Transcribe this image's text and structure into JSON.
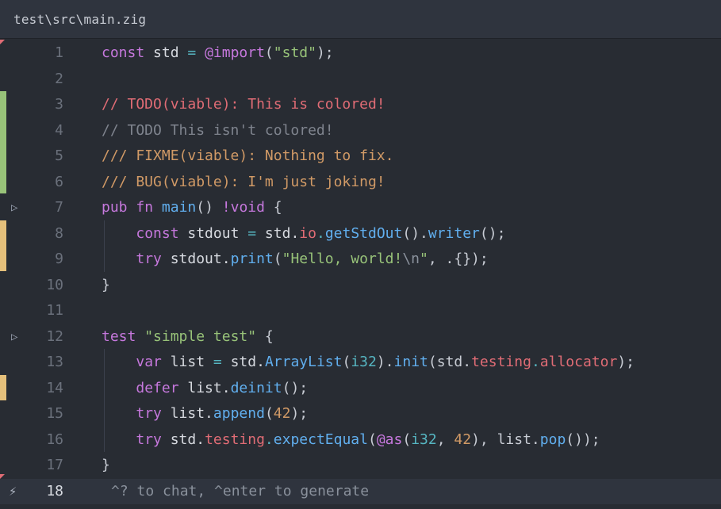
{
  "tab": {
    "path": "test\\src\\main.zig"
  },
  "colors": {
    "background": "#282c33",
    "keyword": "#c678dd",
    "string": "#98c379",
    "function": "#61afef",
    "type": "#56b6c2",
    "number": "#d19a66",
    "todo_comment": "#e06c75",
    "comment": "#7f848e",
    "doc_comment": "#d19a66",
    "git_added": "#98c379",
    "git_modified": "#e5c07b"
  },
  "lines": [
    {
      "number": "1",
      "tokens": [
        {
          "t": "const",
          "c": "k"
        },
        {
          "t": " std ",
          "c": "i"
        },
        {
          "t": "=",
          "c": "t"
        },
        {
          "t": " ",
          "c": "p"
        },
        {
          "t": "@import",
          "c": "k"
        },
        {
          "t": "(",
          "c": "p"
        },
        {
          "t": "\"std\"",
          "c": "s"
        },
        {
          "t": ");",
          "c": "p"
        }
      ]
    },
    {
      "number": "2",
      "tokens": []
    },
    {
      "number": "3",
      "tokens": [
        {
          "t": "// TODO(viable): This is colored!",
          "c": "c1"
        }
      ]
    },
    {
      "number": "4",
      "tokens": [
        {
          "t": "// TODO This isn't colored!",
          "c": "c0"
        }
      ]
    },
    {
      "number": "5",
      "tokens": [
        {
          "t": "/// FIXME(viable): Nothing to fix.",
          "c": "c2"
        }
      ]
    },
    {
      "number": "6",
      "tokens": [
        {
          "t": "/// BUG(viable): I'm just joking!",
          "c": "c2"
        }
      ]
    },
    {
      "number": "7",
      "tokens": [
        {
          "t": "pub",
          "c": "k"
        },
        {
          "t": " ",
          "c": "p"
        },
        {
          "t": "fn",
          "c": "k"
        },
        {
          "t": " ",
          "c": "p"
        },
        {
          "t": "main",
          "c": "f"
        },
        {
          "t": "() ",
          "c": "p"
        },
        {
          "t": "!",
          "c": "k"
        },
        {
          "t": "void",
          "c": "k"
        },
        {
          "t": " {",
          "c": "p"
        }
      ]
    },
    {
      "number": "8",
      "tokens": [
        {
          "t": "    ",
          "c": "p"
        },
        {
          "t": "const",
          "c": "k"
        },
        {
          "t": " stdout ",
          "c": "i"
        },
        {
          "t": "=",
          "c": "t"
        },
        {
          "t": " std.",
          "c": "i"
        },
        {
          "t": "io",
          "c": "m"
        },
        {
          "t": ".",
          "c": "t"
        },
        {
          "t": "getStdOut",
          "c": "f"
        },
        {
          "t": "().",
          "c": "p"
        },
        {
          "t": "writer",
          "c": "f"
        },
        {
          "t": "();",
          "c": "p"
        }
      ]
    },
    {
      "number": "9",
      "tokens": [
        {
          "t": "    ",
          "c": "p"
        },
        {
          "t": "try",
          "c": "k"
        },
        {
          "t": " stdout.",
          "c": "i"
        },
        {
          "t": "print",
          "c": "f"
        },
        {
          "t": "(",
          "c": "p"
        },
        {
          "t": "\"Hello, world!",
          "c": "s"
        },
        {
          "t": "\\n",
          "c": "esc"
        },
        {
          "t": "\"",
          "c": "s"
        },
        {
          "t": ", .{});",
          "c": "p"
        }
      ]
    },
    {
      "number": "10",
      "tokens": [
        {
          "t": "}",
          "c": "p"
        }
      ]
    },
    {
      "number": "11",
      "tokens": []
    },
    {
      "number": "12",
      "tokens": [
        {
          "t": "test",
          "c": "k"
        },
        {
          "t": " ",
          "c": "p"
        },
        {
          "t": "\"simple test\"",
          "c": "s"
        },
        {
          "t": " {",
          "c": "p"
        }
      ]
    },
    {
      "number": "13",
      "tokens": [
        {
          "t": "    ",
          "c": "p"
        },
        {
          "t": "var",
          "c": "k"
        },
        {
          "t": " list ",
          "c": "i"
        },
        {
          "t": "=",
          "c": "t"
        },
        {
          "t": " std.",
          "c": "i"
        },
        {
          "t": "ArrayList",
          "c": "f"
        },
        {
          "t": "(",
          "c": "p"
        },
        {
          "t": "i32",
          "c": "t"
        },
        {
          "t": ").",
          "c": "p"
        },
        {
          "t": "init",
          "c": "f"
        },
        {
          "t": "(std.",
          "c": "p"
        },
        {
          "t": "testing",
          "c": "m"
        },
        {
          "t": ".",
          "c": "t"
        },
        {
          "t": "allocator",
          "c": "m"
        },
        {
          "t": ");",
          "c": "p"
        }
      ]
    },
    {
      "number": "14",
      "tokens": [
        {
          "t": "    ",
          "c": "p"
        },
        {
          "t": "defer",
          "c": "k"
        },
        {
          "t": " list.",
          "c": "i"
        },
        {
          "t": "deinit",
          "c": "f"
        },
        {
          "t": "();",
          "c": "p"
        }
      ]
    },
    {
      "number": "15",
      "tokens": [
        {
          "t": "    ",
          "c": "p"
        },
        {
          "t": "try",
          "c": "k"
        },
        {
          "t": " list.",
          "c": "i"
        },
        {
          "t": "append",
          "c": "f"
        },
        {
          "t": "(",
          "c": "p"
        },
        {
          "t": "42",
          "c": "n"
        },
        {
          "t": ");",
          "c": "p"
        }
      ]
    },
    {
      "number": "16",
      "tokens": [
        {
          "t": "    ",
          "c": "p"
        },
        {
          "t": "try",
          "c": "k"
        },
        {
          "t": " std.",
          "c": "i"
        },
        {
          "t": "testing",
          "c": "m"
        },
        {
          "t": ".",
          "c": "t"
        },
        {
          "t": "expectEqual",
          "c": "f"
        },
        {
          "t": "(",
          "c": "p"
        },
        {
          "t": "@as",
          "c": "k"
        },
        {
          "t": "(",
          "c": "p"
        },
        {
          "t": "i32",
          "c": "t"
        },
        {
          "t": ", ",
          "c": "p"
        },
        {
          "t": "42",
          "c": "n"
        },
        {
          "t": "), list.",
          "c": "p"
        },
        {
          "t": "pop",
          "c": "f"
        },
        {
          "t": "());",
          "c": "p"
        }
      ]
    },
    {
      "number": "17",
      "tokens": [
        {
          "t": "}",
          "c": "p"
        }
      ]
    },
    {
      "number": "18",
      "tokens": []
    }
  ],
  "inline_hint": "^? to chat, ^enter to generate",
  "gutter": {
    "fold_glyph": "▷",
    "zap_glyph": "⚡"
  }
}
